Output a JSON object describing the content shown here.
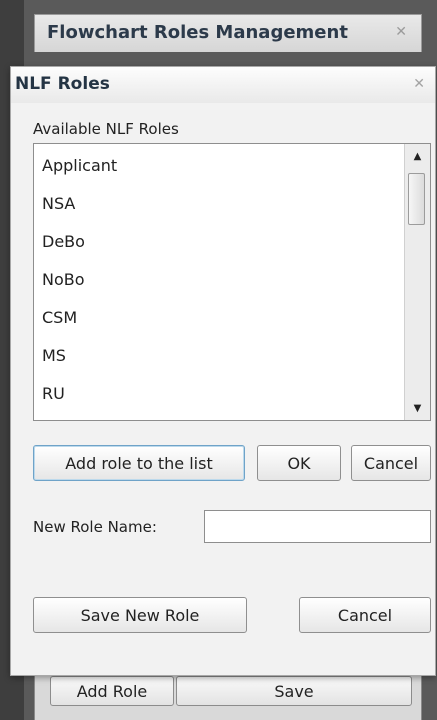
{
  "background_dialog": {
    "title": "Flowchart Roles Management",
    "close_glyph": "✕",
    "add_role_label": "Add Role",
    "save_label": "Save"
  },
  "modal": {
    "title": "NLF Roles",
    "close_glyph": "✕",
    "list_label": "Available NLF Roles",
    "roles": [
      "Applicant",
      "NSA",
      "DeBo",
      "NoBo",
      "CSM",
      "MS",
      "RU"
    ],
    "add_button": "Add role to the list",
    "ok_button": "OK",
    "cancel_button": "Cancel",
    "new_role_label": "New Role Name:",
    "new_role_value": "",
    "save_new_button": "Save New Role",
    "cancel_bottom_button": "Cancel"
  },
  "icons": {
    "scroll_up": "▲",
    "scroll_down": "▼"
  }
}
